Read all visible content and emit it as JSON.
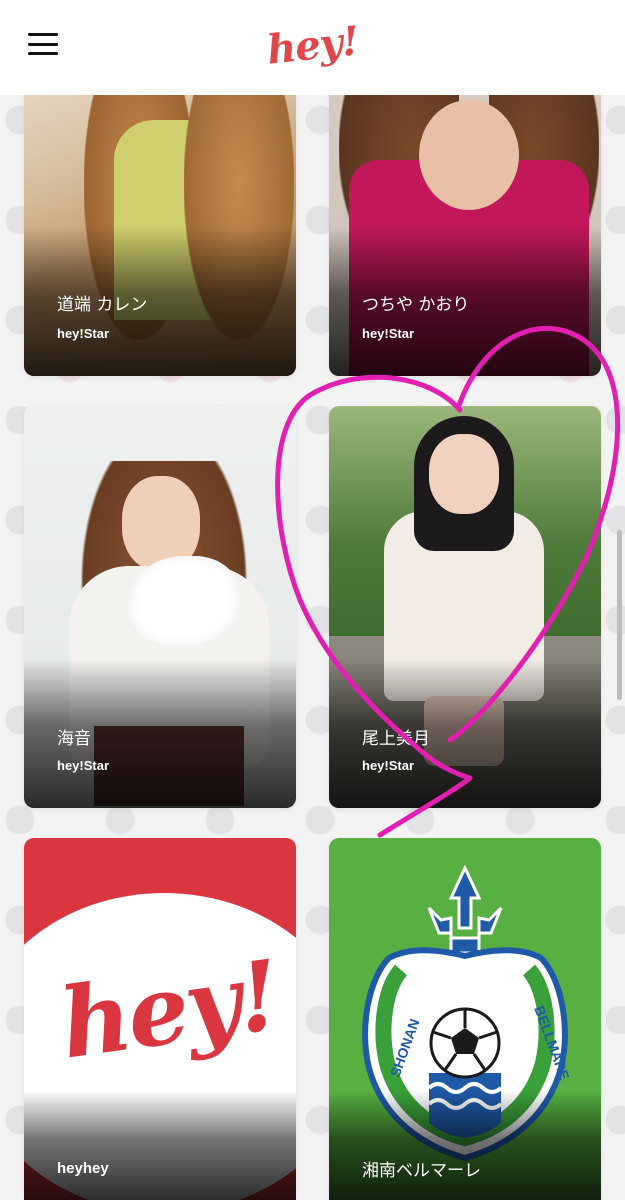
{
  "header": {
    "logo_text": "hey!",
    "menu_icon": "hamburger-menu-icon"
  },
  "cards": [
    {
      "name": "道端 カレン",
      "subtitle": "hey!Star"
    },
    {
      "name": "つちや かおり",
      "subtitle": "hey!Star"
    },
    {
      "name": "海音",
      "subtitle": "hey!Star"
    },
    {
      "name": "尾上美月",
      "subtitle": "hey!Star"
    },
    {
      "name": "heyhey",
      "logo_text": "hey!"
    },
    {
      "name": "湘南ベルマーレ",
      "crest_text_left": "SHONAN",
      "crest_text_right": "BELLMARE"
    }
  ],
  "colors": {
    "brand_red": "#e0474c",
    "heart_pink": "#e21fb0",
    "bellmare_green": "#57b041",
    "bellmare_blue": "#1f5aa8"
  }
}
